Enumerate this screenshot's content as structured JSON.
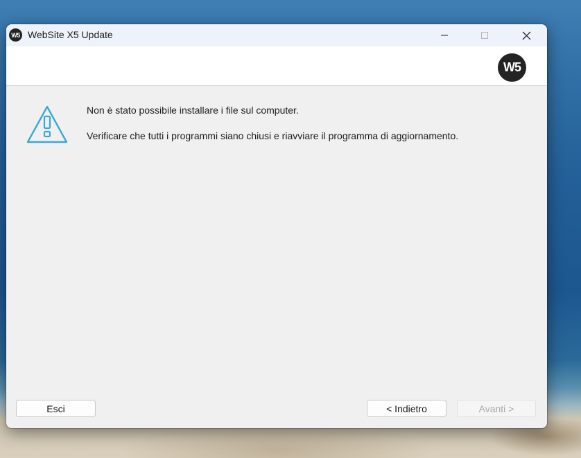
{
  "window": {
    "title": "WebSite X5 Update",
    "app_icon_text": "W5",
    "controls": {
      "minimize_icon": "minimize-icon",
      "maximize_icon": "maximize-icon",
      "close_icon": "close-icon"
    }
  },
  "header": {
    "logo_text": "W5"
  },
  "content": {
    "icon": "warning-triangle-icon",
    "line1": "Non è stato possibile installare i file sul computer.",
    "line2": "Verificare che tutti i programmi siano chiusi e riavviare il programma di aggiornamento."
  },
  "footer": {
    "cancel_label": "Esci",
    "back_label": "< Indietro",
    "next_label": "Avanti >",
    "next_enabled": false
  },
  "colors": {
    "warning_icon": "#3aa8d8",
    "window_bg": "#f0f0f0",
    "titlebar_bg": "#eef2fa"
  }
}
